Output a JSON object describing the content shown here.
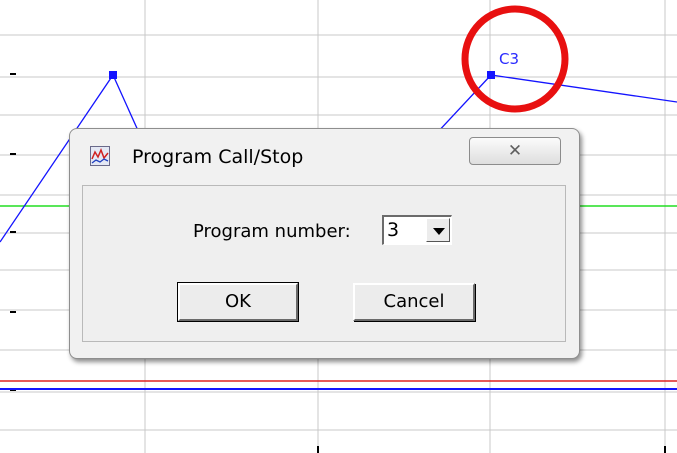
{
  "chart_data": {
    "type": "line",
    "point_label": "C3",
    "colors": {
      "grid": "#c8c8c8",
      "series": "#1414ff",
      "green_line": "#22dd22",
      "red_line": "#dd2222",
      "blue_line": "#1414ff",
      "highlight_circle": "#e81010"
    }
  },
  "dialog": {
    "title": "Program Call/Stop",
    "app_icon": "chart-app-icon",
    "close_icon": "close-icon",
    "close_glyph": "✕",
    "program_number_label": "Program number:",
    "program_number_value": "3",
    "ok_label": "OK",
    "cancel_label": "Cancel"
  }
}
